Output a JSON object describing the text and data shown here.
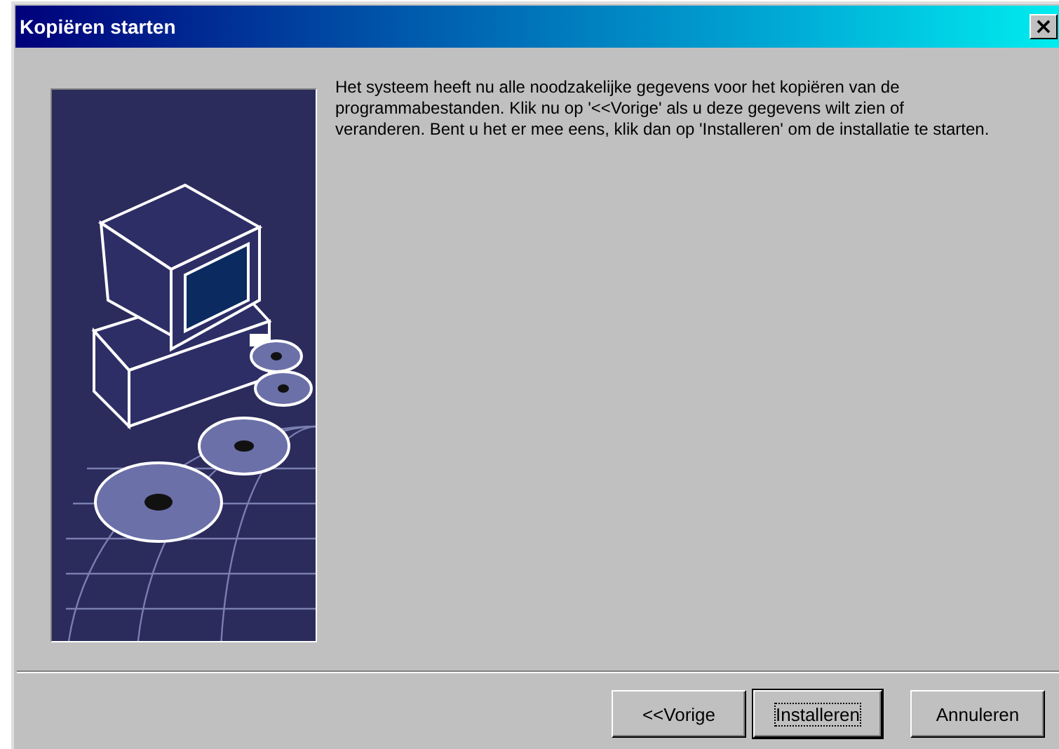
{
  "window": {
    "title": "Kopiëren starten",
    "close_glyph": "×"
  },
  "message": "Het systeem heeft nu alle noodzakelijke gegevens voor het kopiëren van de programmabestanden. Klik nu op '<<Vorige' als u deze gegevens wilt zien of veranderen. Bent u het er mee eens, klik dan op 'Installeren' om de installatie te starten.",
  "buttons": [
    {
      "label": "<<Vorige",
      "default": false
    },
    {
      "label": "Installeren",
      "default": true
    },
    {
      "label": "Annuleren",
      "default": false
    }
  ]
}
